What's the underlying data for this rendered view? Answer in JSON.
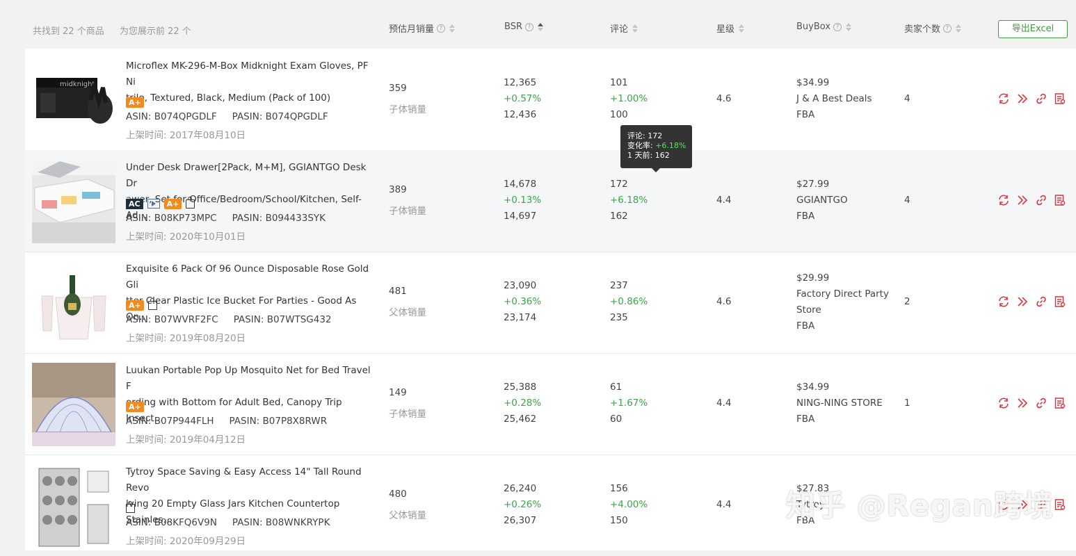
{
  "summary": {
    "found": "共找到 22 个商品",
    "showing": "为您展示前 22 个"
  },
  "headers": {
    "monthly_sales": "预估月销量",
    "bsr": "BSR",
    "reviews": "评论",
    "rating": "星级",
    "buybox": "BuyBox",
    "sellers": "卖家个数"
  },
  "export_label": "导出Excel",
  "rows": [
    {
      "title_line1": "Microflex MK-296-M-Box Midknight Exam Gloves, PF Ni",
      "title_line2": "trile, Textured, Black, Medium (Pack of 100)",
      "asin": "ASIN: B074QPGDLF",
      "pasin": "PASIN: B074QPGDLF",
      "date": "上架时间: 2017年08月10日",
      "sales": "359",
      "sales_type": "子体销量",
      "bsr": "12,365",
      "bsr_change": "+0.57%",
      "bsr_prev": "12,436",
      "reviews": "101",
      "reviews_change": "+1.00%",
      "reviews_prev": "100",
      "rating": "4.6",
      "price": "$34.99",
      "seller": "J & A Best Deals",
      "seller2": "",
      "fulfill": "FBA",
      "sellers": "4",
      "badges": [
        "A+"
      ]
    },
    {
      "title_line1": "Under Desk Drawer[2Pack, M+M], GGIANTGO Desk Dr",
      "title_line2": "awer, Set for Office/Bedroom/School/Kitchen, Self-Ad...",
      "asin": "ASIN: B08KP73MPC",
      "pasin": "PASIN: B094433SYK",
      "date": "上架时间: 2020年10月01日",
      "sales": "389",
      "sales_type": "子体销量",
      "bsr": "14,678",
      "bsr_change": "+0.13%",
      "bsr_prev": "14,697",
      "reviews": "172",
      "reviews_change": "+6.18%",
      "reviews_prev": "162",
      "rating": "4.4",
      "price": "$27.99",
      "seller": "GGIANTGO",
      "seller2": "",
      "fulfill": "FBA",
      "sellers": "4",
      "badges": [
        "AC",
        "video",
        "A+",
        "bag"
      ]
    },
    {
      "title_line1": "Exquisite 6 Pack Of 96 Ounce Disposable Rose Gold Gli",
      "title_line2": "tter Clear Plastic Ice Bucket For Parties - Good As On...",
      "asin": "ASIN: B07WVRF2FC",
      "pasin": "PASIN: B07WTSG432",
      "date": "上架时间: 2019年08月20日",
      "sales": "481",
      "sales_type": "父体销量",
      "bsr": "23,090",
      "bsr_change": "+0.36%",
      "bsr_prev": "23,174",
      "reviews": "237",
      "reviews_change": "+0.86%",
      "reviews_prev": "235",
      "rating": "4.6",
      "price": "$29.99",
      "seller": "Factory Direct Party",
      "seller2": "Store",
      "fulfill": "FBA",
      "sellers": "2",
      "badges": [
        "A+",
        "bag"
      ]
    },
    {
      "title_line1": "Luukan Portable Pop Up Mosquito Net for Bed Travel F",
      "title_line2": "ording with Bottom for Adult Bed, Canopy Trip Insect...",
      "asin": "ASIN: B07P944FLH",
      "pasin": "PASIN: B07P8X8RWR",
      "date": "上架时间: 2019年04月12日",
      "sales": "149",
      "sales_type": "子体销量",
      "bsr": "25,388",
      "bsr_change": "+0.28%",
      "bsr_prev": "25,462",
      "reviews": "61",
      "reviews_change": "+1.67%",
      "reviews_prev": "60",
      "rating": "4.4",
      "price": "$34.99",
      "seller": "NING-NING STORE",
      "seller2": "",
      "fulfill": "FBA",
      "sellers": "1",
      "badges": [
        "A+"
      ]
    },
    {
      "title_line1": "Tytroy Space Saving & Easy Access 14\" Tall Round Revo",
      "title_line2": "lving 20 Empty Glass Jars Kitchen Countertop Stainles...",
      "asin": "ASIN: B08KFQ6V9N",
      "pasin": "PASIN: B08WNKRYPK",
      "date": "上架时间: 2020年09月29日",
      "sales": "480",
      "sales_type": "父体销量",
      "bsr": "26,240",
      "bsr_change": "+0.26%",
      "bsr_prev": "26,307",
      "reviews": "156",
      "reviews_change": "+4.00%",
      "reviews_prev": "150",
      "rating": "4.4",
      "price": "$27.83",
      "seller": "Tytroy",
      "seller2": "",
      "fulfill": "FBA",
      "sellers": "",
      "badges": [
        "bag"
      ]
    }
  ],
  "tooltip": {
    "line1": "评论: 172",
    "line2_label": "变化率: ",
    "line2_value": "+6.18%",
    "line3": "1 天前: 162"
  },
  "watermark": "知乎 @Regan跨境",
  "colors": {
    "accent_green": "#3aa64a",
    "badge_orange": "#f28a1e",
    "action_red": "#d9363e"
  }
}
